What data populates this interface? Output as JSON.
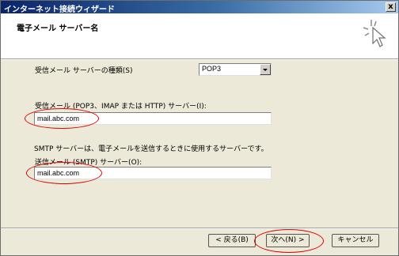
{
  "window": {
    "title": "インターネット接続ウィザード",
    "close_glyph": "x"
  },
  "header": {
    "title": "電子メール サーバー名"
  },
  "form": {
    "server_type_label": "受信メール サーバーの種類(S)",
    "server_type_value": "POP3",
    "incoming_label": "受信メール (POP3、IMAP または HTTP) サーバー(I):",
    "incoming_value": "mail.abc.com",
    "smtp_description": "SMTP サーバーは、電子メールを送信するときに使用するサーバーです。",
    "outgoing_label": "送信メール (SMTP) サーバー(O):",
    "outgoing_value": "mail.abc.com"
  },
  "buttons": {
    "back": "< 戻る(B)",
    "next": "次へ(N) >",
    "cancel": "キャンセル"
  },
  "colors": {
    "title_bar": "#0a246a",
    "annotation_circle": "#e00000"
  }
}
